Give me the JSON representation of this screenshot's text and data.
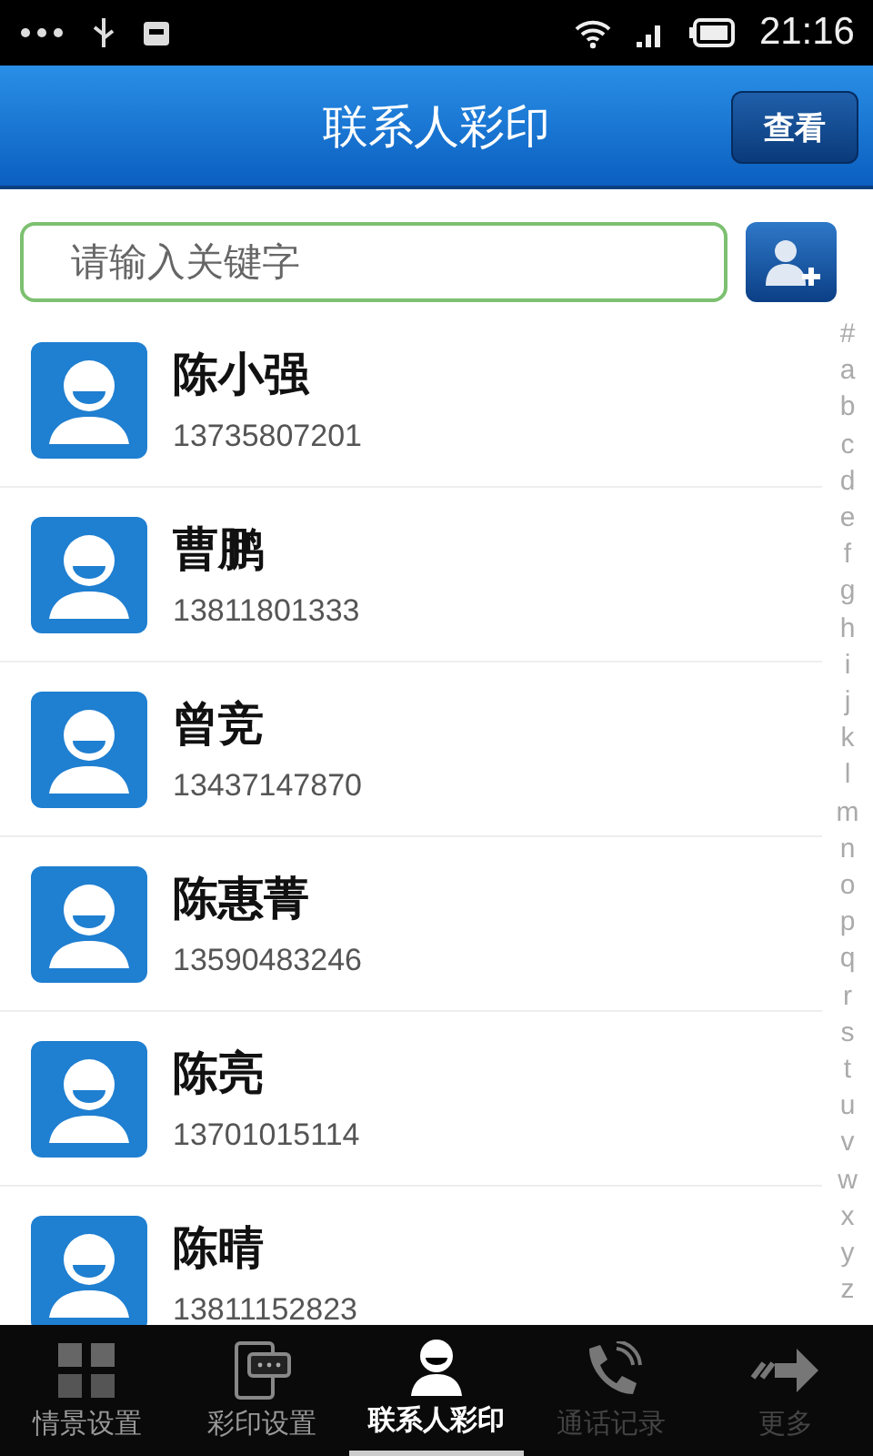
{
  "status_bar": {
    "time": "21:16"
  },
  "header": {
    "title": "联系人彩印",
    "button": "查看"
  },
  "search": {
    "placeholder": "请输入关键字"
  },
  "contacts": [
    {
      "name": "陈小强",
      "phone": "13735807201"
    },
    {
      "name": "曹鹏",
      "phone": "13811801333"
    },
    {
      "name": "曾竞",
      "phone": "13437147870"
    },
    {
      "name": "陈惠菁",
      "phone": "13590483246"
    },
    {
      "name": "陈亮",
      "phone": "13701015114"
    },
    {
      "name": "陈晴",
      "phone": "13811152823"
    }
  ],
  "index": [
    "#",
    "a",
    "b",
    "c",
    "d",
    "e",
    "f",
    "g",
    "h",
    "i",
    "j",
    "k",
    "l",
    "m",
    "n",
    "o",
    "p",
    "q",
    "r",
    "s",
    "t",
    "u",
    "v",
    "w",
    "x",
    "y",
    "z"
  ],
  "tabs": [
    {
      "kind": "grid",
      "label": "情景设置",
      "selected": false,
      "disabled": false
    },
    {
      "kind": "tablet",
      "label": "彩印设置",
      "selected": false,
      "disabled": false
    },
    {
      "kind": "person",
      "label": "联系人彩印",
      "selected": true,
      "disabled": false
    },
    {
      "kind": "phone",
      "label": "通话记录",
      "selected": false,
      "disabled": true
    },
    {
      "kind": "arrow",
      "label": "更多",
      "selected": false,
      "disabled": true
    }
  ]
}
